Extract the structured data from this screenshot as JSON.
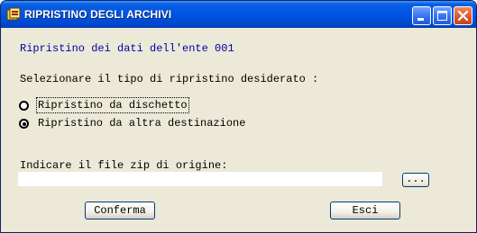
{
  "window": {
    "title": "RIPRISTINO DEGLI ARCHIVI",
    "icon": "archive-app-icon"
  },
  "titlebar_buttons": {
    "minimize": "minimize-icon",
    "maximize": "maximize-icon",
    "close": "close-icon"
  },
  "dialog": {
    "subtitle": "Ripristino dei dati dell'ente 001",
    "prompt": "Selezionare il tipo di ripristino desiderato :",
    "options": [
      {
        "label": "Ripristino da dischetto",
        "selected": false
      },
      {
        "label": "Ripristino da altra destinazione",
        "selected": true
      }
    ],
    "zip_label": "Indicare il file zip di origine:",
    "zip_value": "",
    "browse_label": "...",
    "confirm_label": "Conferma",
    "exit_label": "Esci"
  },
  "colors": {
    "titlebar": "#0054e3",
    "dialog_bg": "#ece9d8",
    "subtitle_text": "#0000a8"
  }
}
